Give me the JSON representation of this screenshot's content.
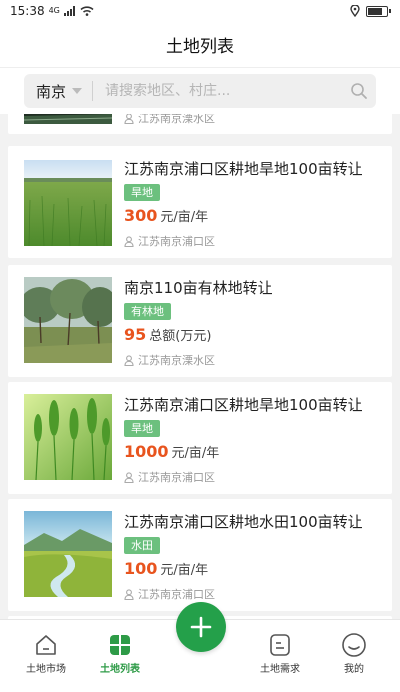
{
  "status": {
    "time": "15:38",
    "net": "4G"
  },
  "header": {
    "title": "土地列表"
  },
  "search": {
    "city": "南京",
    "placeholder": "请搜索地区、村庄..."
  },
  "partial_top": {
    "location": "江苏南京溧水区"
  },
  "listings": [
    {
      "title": "江苏南京浦口区耕地旱地100亩转让",
      "tag": "旱地",
      "price": "300",
      "unit": "元/亩/年",
      "location": "江苏南京浦口区",
      "image": "grass-field"
    },
    {
      "title": "南京110亩有林地转让",
      "tag": "有林地",
      "price": "95",
      "unit": "总额(万元)",
      "location": "江苏南京溧水区",
      "image": "forest"
    },
    {
      "title": "江苏南京浦口区耕地旱地100亩转让",
      "tag": "旱地",
      "price": "1000",
      "unit": "元/亩/年",
      "location": "江苏南京浦口区",
      "image": "wheat"
    },
    {
      "title": "江苏南京浦口区耕地水田100亩转让",
      "tag": "水田",
      "price": "100",
      "unit": "元/亩/年",
      "location": "江苏南京浦口区",
      "image": "valley-river"
    }
  ],
  "tabbar": {
    "items": [
      {
        "label": "土地市场",
        "icon": "home-icon"
      },
      {
        "label": "土地列表",
        "icon": "grid-icon"
      },
      {
        "label": "",
        "icon": "plus-icon"
      },
      {
        "label": "土地需求",
        "icon": "document-icon"
      },
      {
        "label": "我的",
        "icon": "profile-icon"
      }
    ],
    "active": "土地列表"
  },
  "colors": {
    "accent": "#24a04a",
    "price": "#e8541e",
    "tag": "#6cc07e"
  }
}
